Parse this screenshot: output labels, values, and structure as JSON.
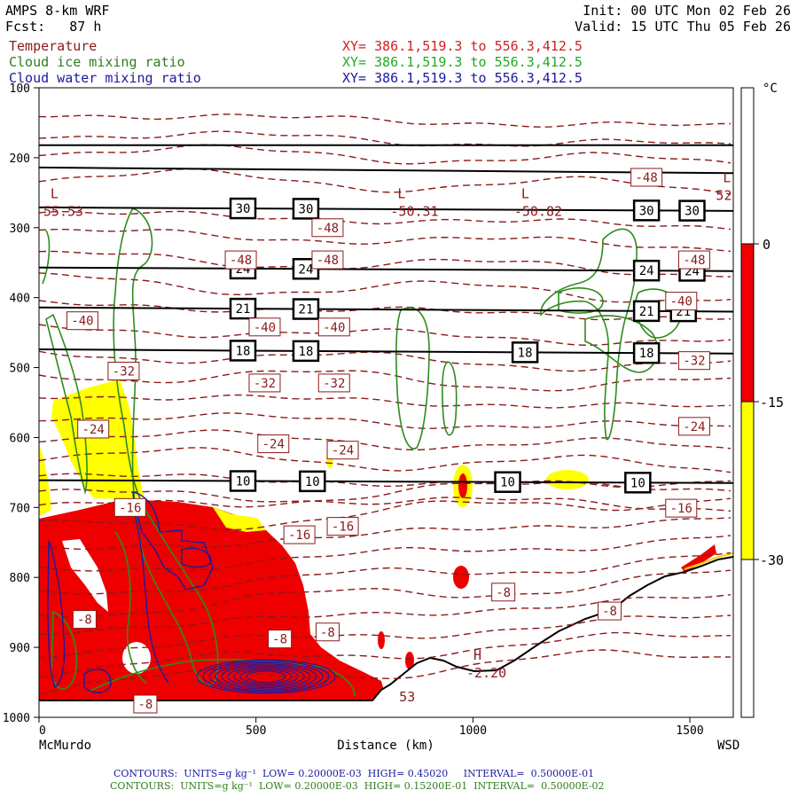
{
  "header": {
    "model": "AMPS 8-km WRF",
    "forecast": "Fcst:   87 h",
    "init": "Init: 00 UTC Mon 02 Feb 26",
    "valid": "Valid: 15 UTC Thu 05 Feb 26",
    "fields": [
      {
        "name": "Temperature",
        "xy": "XY= 386.1,519.3 to 556.3,412.5",
        "color": "#8b1a1a"
      },
      {
        "name": "Cloud ice mixing ratio",
        "xy": "XY= 386.1,519.3 to 556.3,412.5",
        "color": "#2e7d1e"
      },
      {
        "name": "Cloud water mixing ratio",
        "xy": "XY= 386.1,519.3 to 556.3,412.5",
        "color": "#1a1aa0"
      }
    ]
  },
  "footer": {
    "water_contours": "CONTOURS:  UNITS=g kg⁻¹  LOW= 0.20000E-03  HIGH= 0.45020     INTERVAL=  0.50000E-01",
    "ice_contours": "CONTOURS:  UNITS=g kg⁻¹  LOW= 0.20000E-03  HIGH= 0.15200E-01  INTERVAL=  0.50000E-02"
  },
  "chart_data": {
    "type": "cross-section",
    "xlabel": "Distance (km)",
    "x_start_label": "McMurdo",
    "x_end_label": "WSD",
    "xlim": [
      0,
      1600
    ],
    "ylim": [
      1000,
      100
    ],
    "x_ticks": [
      0,
      500,
      1000,
      1500
    ],
    "y_ticks": [
      100,
      200,
      300,
      400,
      500,
      600,
      700,
      800,
      900,
      1000
    ],
    "colorbar": {
      "unit": "°C",
      "ticks": [
        "0",
        "-15",
        "-30"
      ],
      "bands": [
        {
          "from": 0,
          "to": -15,
          "color": "#ee0000"
        },
        {
          "from": -15,
          "to": -30,
          "color": "#ffff00"
        }
      ]
    },
    "isotherm_labels": [
      {
        "text": "-48",
        "x": 1400,
        "p": 228
      },
      {
        "text": "-48",
        "x": 665,
        "p": 300
      },
      {
        "text": "-48",
        "x": 465,
        "p": 346
      },
      {
        "text": "-48",
        "x": 665,
        "p": 346
      },
      {
        "text": "-48",
        "x": 1510,
        "p": 346
      },
      {
        "text": "-40",
        "x": 100,
        "p": 433
      },
      {
        "text": "-40",
        "x": 520,
        "p": 442
      },
      {
        "text": "-40",
        "x": 680,
        "p": 442
      },
      {
        "text": "-40",
        "x": 1480,
        "p": 405
      },
      {
        "text": "-32",
        "x": 195,
        "p": 505
      },
      {
        "text": "-32",
        "x": 520,
        "p": 522
      },
      {
        "text": "-32",
        "x": 680,
        "p": 522
      },
      {
        "text": "-32",
        "x": 1510,
        "p": 490
      },
      {
        "text": "-24",
        "x": 125,
        "p": 588
      },
      {
        "text": "-24",
        "x": 540,
        "p": 609
      },
      {
        "text": "-24",
        "x": 700,
        "p": 618
      },
      {
        "text": "-24",
        "x": 1510,
        "p": 584
      },
      {
        "text": "-16",
        "x": 210,
        "p": 700
      },
      {
        "text": "-16",
        "x": 600,
        "p": 739
      },
      {
        "text": "-16",
        "x": 700,
        "p": 727
      },
      {
        "text": "-16",
        "x": 1480,
        "p": 701
      },
      {
        "text": "-8",
        "x": 105,
        "p": 860
      },
      {
        "text": "-8",
        "x": 555,
        "p": 888
      },
      {
        "text": "-8",
        "x": 665,
        "p": 878
      },
      {
        "text": "-8",
        "x": 1070,
        "p": 821
      },
      {
        "text": "-8",
        "x": 1315,
        "p": 848
      },
      {
        "text": "-8",
        "x": 245,
        "p": 981
      }
    ],
    "extrema": [
      {
        "symbol": "L",
        "value": "55.53",
        "x": 10,
        "p": 278
      },
      {
        "symbol": "L",
        "value": "-50.31",
        "x": 810,
        "p": 278
      },
      {
        "symbol": "L",
        "value": "-50.82",
        "x": 1095,
        "p": 278
      },
      {
        "symbol": "L",
        "value": "52",
        "x": 1560,
        "p": 255
      },
      {
        "symbol": "H",
        "value": "-2.20",
        "x": 985,
        "p": 938
      },
      {
        "symbol": "",
        "value": "53",
        "x": 830,
        "p": 972
      }
    ],
    "height_lines": [
      {
        "label": "30",
        "p_left": 271,
        "p_right": 276,
        "boxes": [
          470,
          615,
          1400,
          1505
        ]
      },
      {
        "label": "24",
        "p_left": 357,
        "p_right": 362,
        "boxes": [
          470,
          615,
          1400,
          1505
        ]
      },
      {
        "label": "21",
        "p_left": 414,
        "p_right": 420,
        "boxes": [
          470,
          615,
          1400,
          1485
        ]
      },
      {
        "label": "18",
        "p_left": 474,
        "p_right": 480,
        "boxes": [
          470,
          615,
          1120,
          1400
        ]
      },
      {
        "label": "10",
        "p_left": 661,
        "p_right": 665,
        "boxes": [
          470,
          630,
          1080,
          1380
        ]
      }
    ],
    "top_lines_p": [
      [
        182,
        182
      ],
      [
        214,
        222
      ]
    ]
  }
}
